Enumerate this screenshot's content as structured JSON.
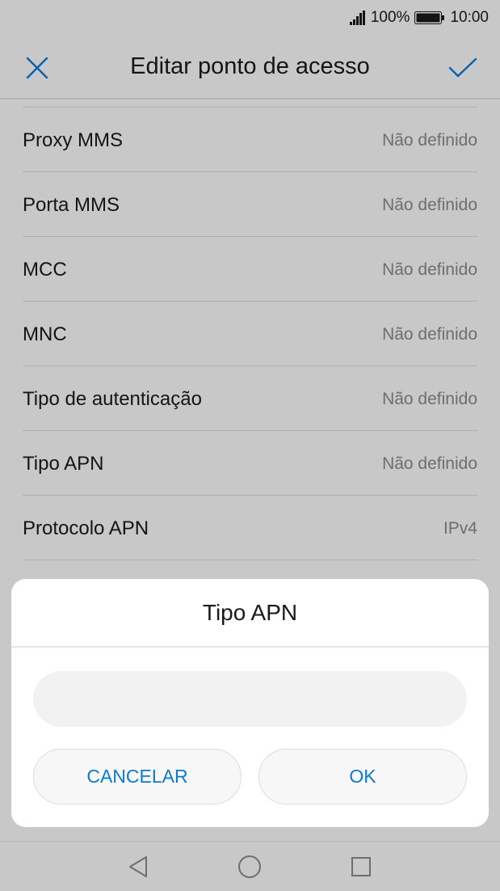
{
  "status_bar": {
    "battery_text": "100%",
    "time": "10:00",
    "icons": [
      "signal-icon",
      "battery-icon"
    ]
  },
  "toolbar": {
    "title": "Editar ponto de acesso",
    "close_icon": "close-icon",
    "confirm_icon": "check-icon"
  },
  "settings": [
    {
      "label": "Proxy MMS",
      "value": "Não definido"
    },
    {
      "label": "Porta MMS",
      "value": "Não definido"
    },
    {
      "label": "MCC",
      "value": "Não definido"
    },
    {
      "label": "MNC",
      "value": "Não definido"
    },
    {
      "label": "Tipo de autenticação",
      "value": "Não definido"
    },
    {
      "label": "Tipo APN",
      "value": "Não definido"
    },
    {
      "label": "Protocolo APN",
      "value": "IPv4"
    },
    {
      "label": "",
      "value": ""
    }
  ],
  "dialog": {
    "title": "Tipo APN",
    "input_value": "",
    "cancel_label": "CANCELAR",
    "ok_label": "OK"
  },
  "navbar": {
    "icons": [
      "back-icon",
      "home-icon",
      "recents-icon"
    ]
  },
  "colors": {
    "accent": "#0a7ad6",
    "background": "#fafafa",
    "secondary_text": "#8a8a8a"
  }
}
